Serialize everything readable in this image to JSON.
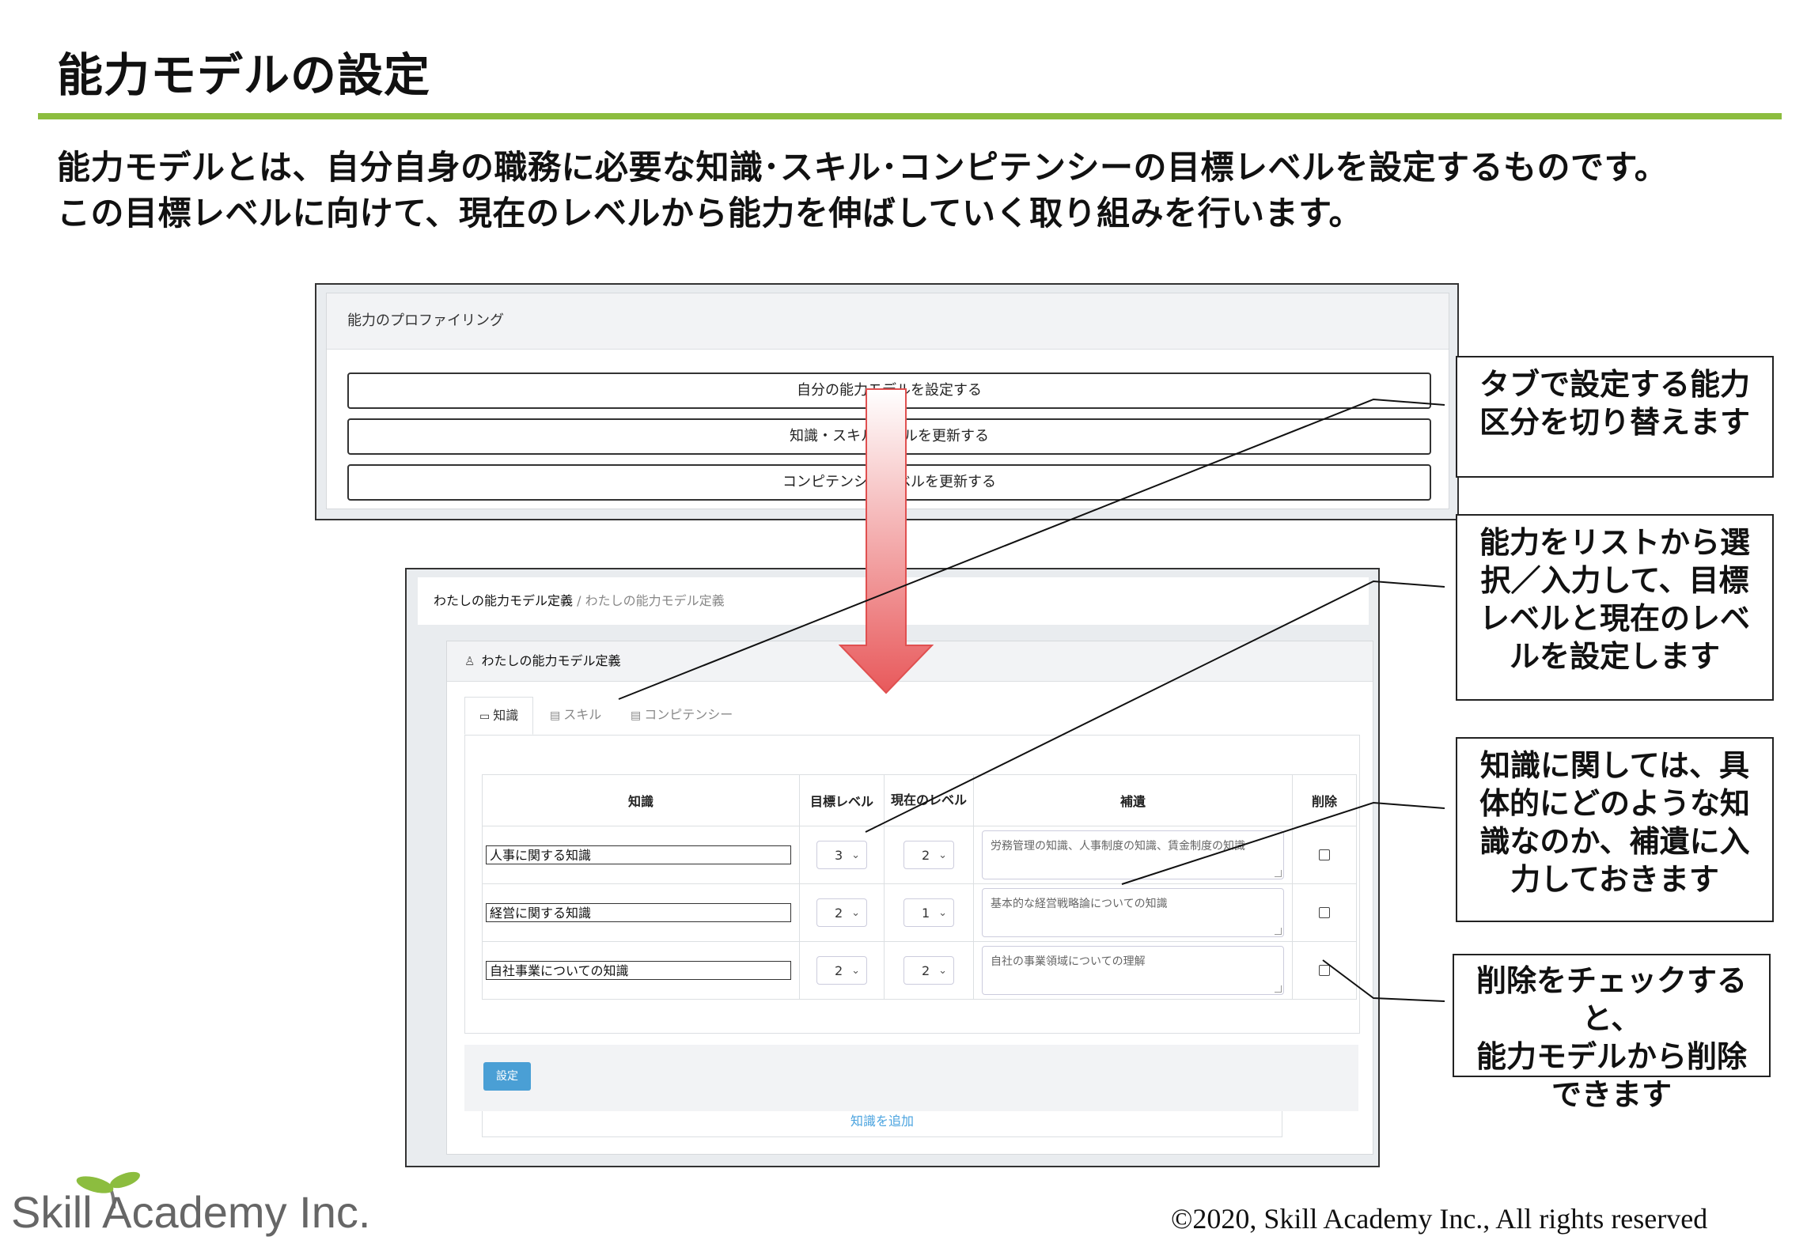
{
  "slide": {
    "title": "能力モデルの設定",
    "intro_line1": "能力モデルとは、自分自身の職務に必要な知識･スキル･コンピテンシーの目標レベルを設定するものです。",
    "intro_line2": "この目標レベルに向けて、現在のレベルから能力を伸ばしていく取り組みを行います。",
    "accent_color": "#8cbd3f"
  },
  "profiling": {
    "header": "能力のプロファイリング",
    "buttons": [
      "自分の能力モデルを設定する",
      "知識・スキルレベルを更新する",
      "コンピテンシーレベルを更新する"
    ]
  },
  "model_def": {
    "breadcrumb": {
      "parent": "わたしの能力モデル定義",
      "separator": "/",
      "current": "わたしの能力モデル定義"
    },
    "panel_title": "わたしの能力モデル定義",
    "panel_icon": "user-icon",
    "tabs": [
      {
        "label": "知識",
        "icon": "book-icon",
        "active": true
      },
      {
        "label": "スキル",
        "icon": "card-icon",
        "active": false
      },
      {
        "label": "コンピテンシー",
        "icon": "card-icon",
        "active": false
      }
    ],
    "table": {
      "headers": {
        "name": "知識",
        "target": "目標レベル",
        "current": "現在のレベル",
        "note": "補遺",
        "delete": "削除"
      },
      "rows": [
        {
          "name": "人事に関する知識",
          "target": "3",
          "current": "2",
          "note": "労務管理の知識、人事制度の知識、賃金制度の知識",
          "delete": false
        },
        {
          "name": "経営に関する知識",
          "target": "2",
          "current": "1",
          "note": "基本的な経営戦略論についての知識",
          "delete": false
        },
        {
          "name": "自社事業についての知識",
          "target": "2",
          "current": "2",
          "note": "自社の事業領域についての理解",
          "delete": false
        }
      ],
      "add_link": "知識を追加"
    },
    "submit_label": "設定",
    "submit_color": "#4a9fd5"
  },
  "callouts": {
    "c1": [
      "タブで設定する能力",
      "区分を切り替えます"
    ],
    "c2": [
      "能力をリストから選",
      "択／入力して、目標",
      "レベルと現在のレベ",
      "ルを設定します"
    ],
    "c3": [
      "知識に関しては、具",
      "体的にどのような知",
      "識なのか、補遺に入",
      "力しておきます"
    ],
    "c4": [
      "削除をチェックすると、",
      "能力モデルから削除",
      "できます"
    ]
  },
  "footer": {
    "logo_text": "Skill Academy Inc.",
    "copyright": "©2020, Skill Academy Inc.,  All rights reserved"
  }
}
